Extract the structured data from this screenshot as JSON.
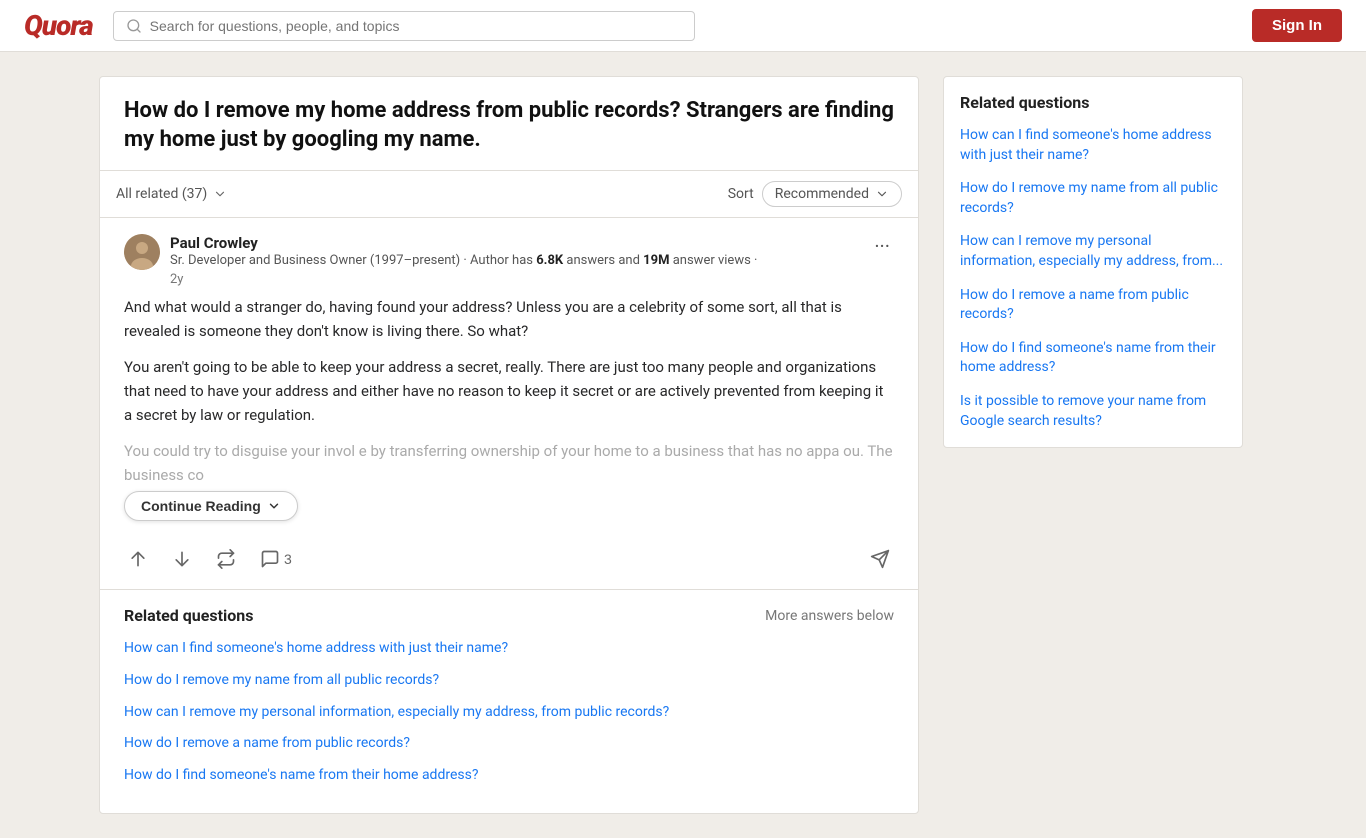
{
  "header": {
    "logo": "Quora",
    "search_placeholder": "Search for questions, people, and topics",
    "sign_in": "Sign In"
  },
  "question": {
    "title": "How do I remove my home address from public records? Strangers are finding my home just by googling my name."
  },
  "answers_bar": {
    "all_related": "All related (37)",
    "sort_label": "Sort",
    "sort_value": "Recommended",
    "chevron": "▾"
  },
  "answer": {
    "author_name": "Paul Crowley",
    "author_desc_prefix": "Sr. Developer and Business Owner (1997–present) · Author has ",
    "answer_count": "6.8K",
    "answer_count_suffix": " answers and ",
    "views_count": "19M",
    "views_suffix": " answer views · ",
    "time": "2y",
    "paragraph1": "And what would a stranger do, having found your address? Unless you are a celebrity of some sort, all that is revealed is someone they don't know is living there. So what?",
    "paragraph2": "You aren't going to be able to keep your address a secret, really. There are just too many people and organizations that need to have your address and either have no reason to keep it secret or are actively prevented from keeping it a secret by law or regulation.",
    "blurred_text": "You could try to disguise your invol                              e by transferring ownership of your home to a business that has no appa                       ou. The business co",
    "continue_reading": "Continue Reading",
    "comment_count": "3"
  },
  "related_questions": {
    "title": "Related questions",
    "more_label": "More answers below",
    "links": [
      "How can I find someone's home address with just their name?",
      "How do I remove my name from all public records?",
      "How can I remove my personal information, especially my address, from public records?",
      "How do I remove a name from public records?",
      "How do I find someone's name from their home address?"
    ]
  },
  "sidebar": {
    "title": "Related questions",
    "links": [
      "How can I find someone's home address with just their name?",
      "How do I remove my name from all public records?",
      "How can I remove my personal information, especially my address, from...",
      "How do I remove a name from public records?",
      "How do I find someone's name from their home address?",
      "Is it possible to remove your name from Google search results?"
    ]
  }
}
